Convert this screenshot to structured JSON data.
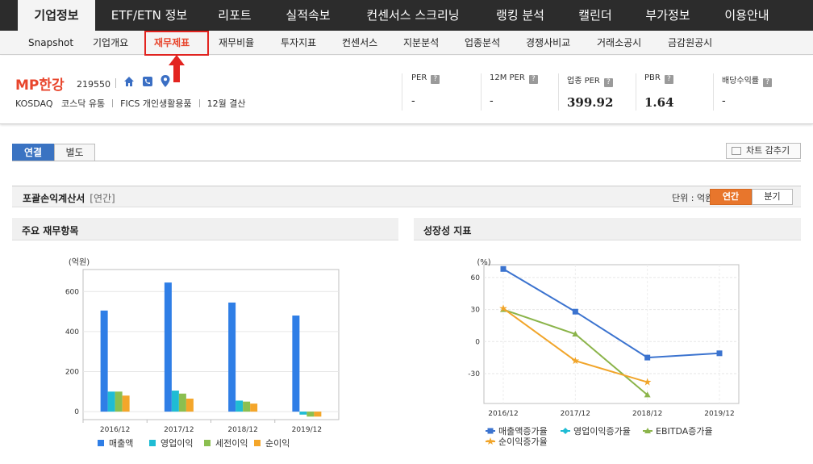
{
  "top_nav": {
    "tabs": [
      "기업정보",
      "ETF/ETN 정보",
      "리포트",
      "실적속보",
      "컨센서스 스크리닝",
      "랭킹 분석",
      "캘린더",
      "부가정보",
      "이용안내"
    ]
  },
  "sub_nav": {
    "items": [
      "Snapshot",
      "기업개요",
      "재무제표",
      "재무비율",
      "투자지표",
      "컨센서스",
      "지분분석",
      "업종분석",
      "경쟁사비교",
      "거래소공시",
      "금감원공시"
    ],
    "active": "재무제표"
  },
  "company": {
    "name": "MP한강",
    "code": "219550",
    "market": "KOSDAQ",
    "sector": "코스닥 유통",
    "fics": "FICS 개인생활용품",
    "settlement": "12월 결산",
    "metrics": [
      {
        "label": "PER",
        "value": "-"
      },
      {
        "label": "12M PER",
        "value": "-"
      },
      {
        "label": "업종 PER",
        "value": "399.92"
      },
      {
        "label": "PBR",
        "value": "1.64"
      },
      {
        "label": "배당수익률",
        "value": "-"
      }
    ]
  },
  "consolidation_tabs": [
    "연결",
    "별도"
  ],
  "hide_chart_label": "차트 감추기",
  "section": {
    "title": "포괄손익계산서",
    "subtitle": "[연간]",
    "unit": "단위 : 억원",
    "period_tabs": [
      "연간",
      "분기"
    ]
  },
  "panels": {
    "left_title": "주요 재무항목",
    "right_title": "성장성 지표"
  },
  "chart_data": [
    {
      "type": "bar",
      "ylabel": "(억원)",
      "categories": [
        "2016/12",
        "2017/12",
        "2018/12",
        "2019/12"
      ],
      "y_ticks": [
        0,
        200,
        400,
        600
      ],
      "ylim": [
        -40,
        710
      ],
      "series": [
        {
          "name": "매출액",
          "color": "#2f7ee6",
          "values": [
            505,
            645,
            545,
            480
          ]
        },
        {
          "name": "영업이익",
          "color": "#1fbcd4",
          "values": [
            100,
            105,
            55,
            -15
          ]
        },
        {
          "name": "세전이익",
          "color": "#8bbf50",
          "values": [
            100,
            90,
            50,
            -25
          ]
        },
        {
          "name": "순이익",
          "color": "#f4a62a",
          "values": [
            80,
            65,
            40,
            -25
          ]
        }
      ],
      "legend": "bottom",
      "grid": true
    },
    {
      "type": "line",
      "ylabel": "(%)",
      "categories": [
        "2016/12",
        "2017/12",
        "2018/12",
        "2019/12"
      ],
      "y_ticks": [
        -30,
        0,
        30,
        60
      ],
      "ylim": [
        -58,
        72
      ],
      "series": [
        {
          "name": "매출액증가율",
          "color": "#3b73cf",
          "marker": "square",
          "values": [
            68,
            28,
            -15,
            -11
          ]
        },
        {
          "name": "영업이익증가율",
          "color": "#1fbcd4",
          "marker": "diamond",
          "values": [
            null,
            null,
            null,
            null
          ]
        },
        {
          "name": "EBITDA증가율",
          "color": "#8bb44a",
          "marker": "triangle",
          "values": [
            30,
            7,
            -50,
            null
          ]
        },
        {
          "name": "순이익증가율",
          "color": "#f1a52a",
          "marker": "star",
          "values": [
            31,
            -18,
            -38,
            null
          ]
        }
      ],
      "legend": "bottom",
      "grid": true
    }
  ]
}
